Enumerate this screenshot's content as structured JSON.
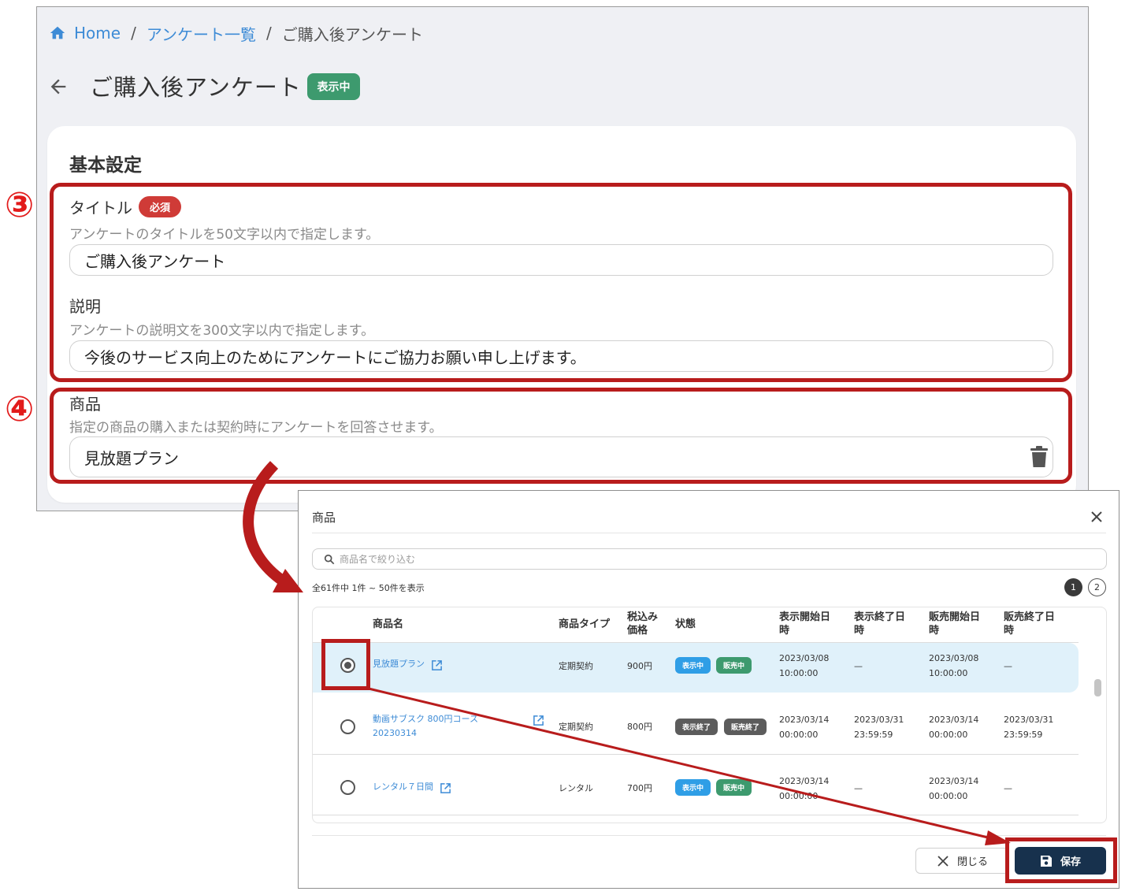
{
  "breadcrumb": {
    "home": "Home",
    "list": "アンケート一覧",
    "current": "ご購入後アンケート",
    "separator": "/"
  },
  "header": {
    "title": "ご購入後アンケート",
    "status_badge": "表示中"
  },
  "basic_settings": {
    "section_title": "基本設定",
    "title_field": {
      "label": "タイトル",
      "required_badge": "必須",
      "help": "アンケートのタイトルを50文字以内で指定します。",
      "value": "ご購入後アンケート"
    },
    "description_field": {
      "label": "説明",
      "help": "アンケートの説明文を300文字以内で指定します。",
      "value": "今後のサービス向上のためにアンケートにご協力お願い申し上げます。"
    },
    "product_field": {
      "label": "商品",
      "help": "指定の商品の購入または契約時にアンケートを回答させます。",
      "value": "見放題プラン"
    }
  },
  "annotations": {
    "step3": "③",
    "step4": "④",
    "highlight_color": "#b81c1c"
  },
  "modal": {
    "title": "商品",
    "search_placeholder": "商品名で絞り込む",
    "result_count": "全61件中 1件 ~ 50件を表示",
    "pages": [
      "1",
      "2"
    ],
    "current_page": "1",
    "columns": {
      "name": "商品名",
      "type": "商品タイプ",
      "price": [
        "税込み",
        "価格"
      ],
      "state": "状態",
      "display_start": [
        "表示開始日",
        "時"
      ],
      "display_end": [
        "表示終了日",
        "時"
      ],
      "sale_start": [
        "販売開始日",
        "時"
      ],
      "sale_end": [
        "販売終了日",
        "時"
      ]
    },
    "rows": [
      {
        "selected": true,
        "name": [
          "見放題プラン"
        ],
        "type": "定期契約",
        "price": "900円",
        "display_status": "表示中",
        "sale_status": "販売中",
        "display_start": [
          "2023/03/08",
          "10:00:00"
        ],
        "display_end": [
          "—"
        ],
        "sale_start": [
          "2023/03/08",
          "10:00:00"
        ],
        "sale_end": [
          "—"
        ]
      },
      {
        "selected": false,
        "name": [
          "動画サブスク 800円コース",
          "20230314"
        ],
        "type": "定期契約",
        "price": "800円",
        "display_status": "表示終了",
        "sale_status": "販売終了",
        "display_start": [
          "2023/03/14",
          "00:00:00"
        ],
        "display_end": [
          "2023/03/31",
          "23:59:59"
        ],
        "sale_start": [
          "2023/03/14",
          "00:00:00"
        ],
        "sale_end": [
          "2023/03/31",
          "23:59:59"
        ]
      },
      {
        "selected": false,
        "name": [
          "レンタル７日間"
        ],
        "type": "レンタル",
        "price": "700円",
        "display_status": "表示中",
        "sale_status": "販売中",
        "display_start": [
          "2023/03/14",
          "00:00:00"
        ],
        "display_end": [
          "—"
        ],
        "sale_start": [
          "2023/03/14",
          "00:00:00"
        ],
        "sale_end": [
          "—"
        ]
      }
    ],
    "close_label": "閉じる",
    "save_label": "保存"
  }
}
